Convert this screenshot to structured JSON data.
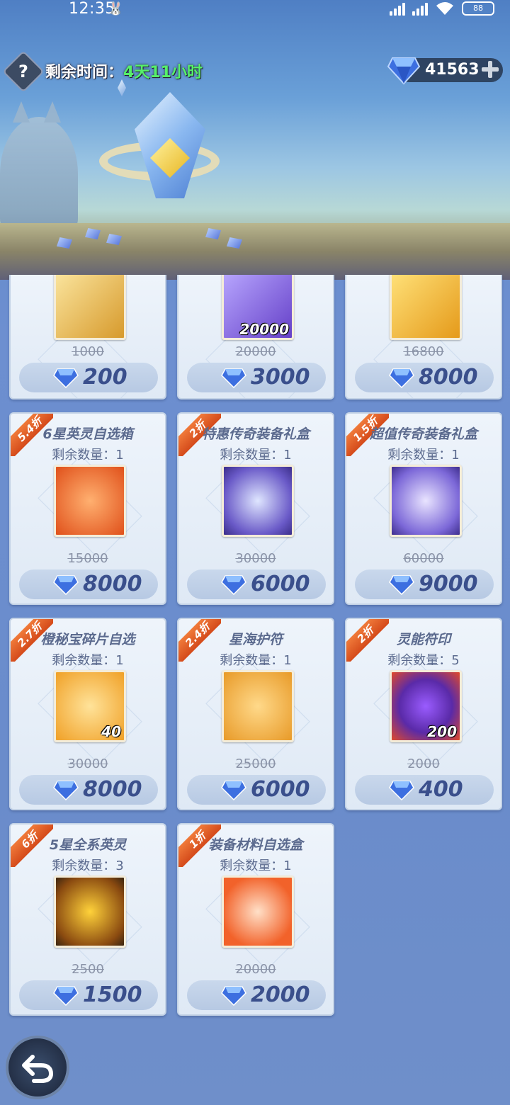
{
  "status_bar": {
    "time": "12:35",
    "battery": "88"
  },
  "header": {
    "help_label": "?",
    "time_label": "剩余时间：",
    "time_value": "4天11小时",
    "currency_amount": "41563"
  },
  "shop": {
    "items": [
      {
        "title": "",
        "qty": "",
        "count": "",
        "old_price": "1000",
        "price": "200",
        "discount": ""
      },
      {
        "title": "",
        "qty": "",
        "count": "20000",
        "old_price": "20000",
        "price": "3000",
        "discount": ""
      },
      {
        "title": "",
        "qty": "",
        "count": "",
        "old_price": "16800",
        "price": "8000",
        "discount": ""
      },
      {
        "title": "6星英灵自选箱",
        "qty": "剩余数量：1",
        "count": "",
        "old_price": "15000",
        "price": "8000",
        "discount": "5.4折"
      },
      {
        "title": "特惠传奇装备礼盒",
        "qty": "剩余数量：1",
        "count": "",
        "old_price": "30000",
        "price": "6000",
        "discount": "2折"
      },
      {
        "title": "超值传奇装备礼盒",
        "qty": "剩余数量：1",
        "count": "",
        "old_price": "60000",
        "price": "9000",
        "discount": "1.5折"
      },
      {
        "title": "橙秘宝碎片自选",
        "qty": "剩余数量：1",
        "count": "40",
        "old_price": "30000",
        "price": "8000",
        "discount": "2.7折"
      },
      {
        "title": "星海护符",
        "qty": "剩余数量：1",
        "count": "",
        "old_price": "25000",
        "price": "6000",
        "discount": "2.4折"
      },
      {
        "title": "灵能符印",
        "qty": "剩余数量：5",
        "count": "200",
        "old_price": "2000",
        "price": "400",
        "discount": "2折"
      },
      {
        "title": "5星全系英灵",
        "qty": "剩余数量：3",
        "count": "",
        "old_price": "2500",
        "price": "1500",
        "discount": "6折"
      },
      {
        "title": "装备材料自选盒",
        "qty": "剩余数量：1",
        "count": "",
        "old_price": "20000",
        "price": "2000",
        "discount": "1折"
      }
    ]
  },
  "colors": {
    "accent": "#3a4f8c",
    "discount": "#e2581f",
    "time_green": "#56f06a"
  }
}
